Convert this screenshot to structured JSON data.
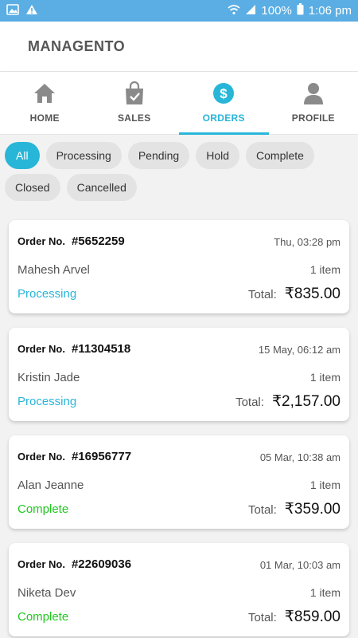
{
  "status_bar": {
    "battery": "100%",
    "time": "1:06 pm",
    "icons": [
      "image-icon",
      "warning-icon",
      "wifi-icon",
      "signal-icon",
      "battery-icon"
    ]
  },
  "app": {
    "title": "MANAGENTO"
  },
  "tabs": [
    {
      "label": "HOME",
      "icon": "home-icon",
      "active": false
    },
    {
      "label": "SALES",
      "icon": "shopping-bag-icon",
      "active": false
    },
    {
      "label": "ORDERS",
      "icon": "dollar-icon",
      "active": true
    },
    {
      "label": "PROFILE",
      "icon": "user-icon",
      "active": false
    }
  ],
  "filters": [
    {
      "label": "All",
      "active": true
    },
    {
      "label": "Processing"
    },
    {
      "label": "Pending"
    },
    {
      "label": "Hold"
    },
    {
      "label": "Complete"
    },
    {
      "label": "Closed"
    },
    {
      "label": "Cancelled"
    }
  ],
  "orders": [
    {
      "order_no_label": "Order No.",
      "id": "#5652259",
      "date": "Thu, 03:28 pm",
      "customer": "Mahesh Arvel",
      "items": "1 item",
      "status": "Processing",
      "total_label": "Total:",
      "total": "₹835.00"
    },
    {
      "order_no_label": "Order No.",
      "id": "#11304518",
      "date": "15 May, 06:12 am",
      "customer": "Kristin Jade",
      "items": "1 item",
      "status": "Processing",
      "total_label": "Total:",
      "total": "₹2,157.00"
    },
    {
      "order_no_label": "Order No.",
      "id": "#16956777",
      "date": "05 Mar, 10:38 am",
      "customer": "Alan Jeanne",
      "items": "1 item",
      "status": "Complete",
      "total_label": "Total:",
      "total": "₹359.00"
    },
    {
      "order_no_label": "Order No.",
      "id": "#22609036",
      "date": "01 Mar, 10:03 am",
      "customer": "Niketa Dev",
      "items": "1 item",
      "status": "Complete",
      "total_label": "Total:",
      "total": "₹859.00"
    }
  ],
  "colors": {
    "accent": "#28b6d8",
    "status_bar": "#5aaee3",
    "complete": "#1fc81f",
    "processing": "#28b6d8"
  }
}
